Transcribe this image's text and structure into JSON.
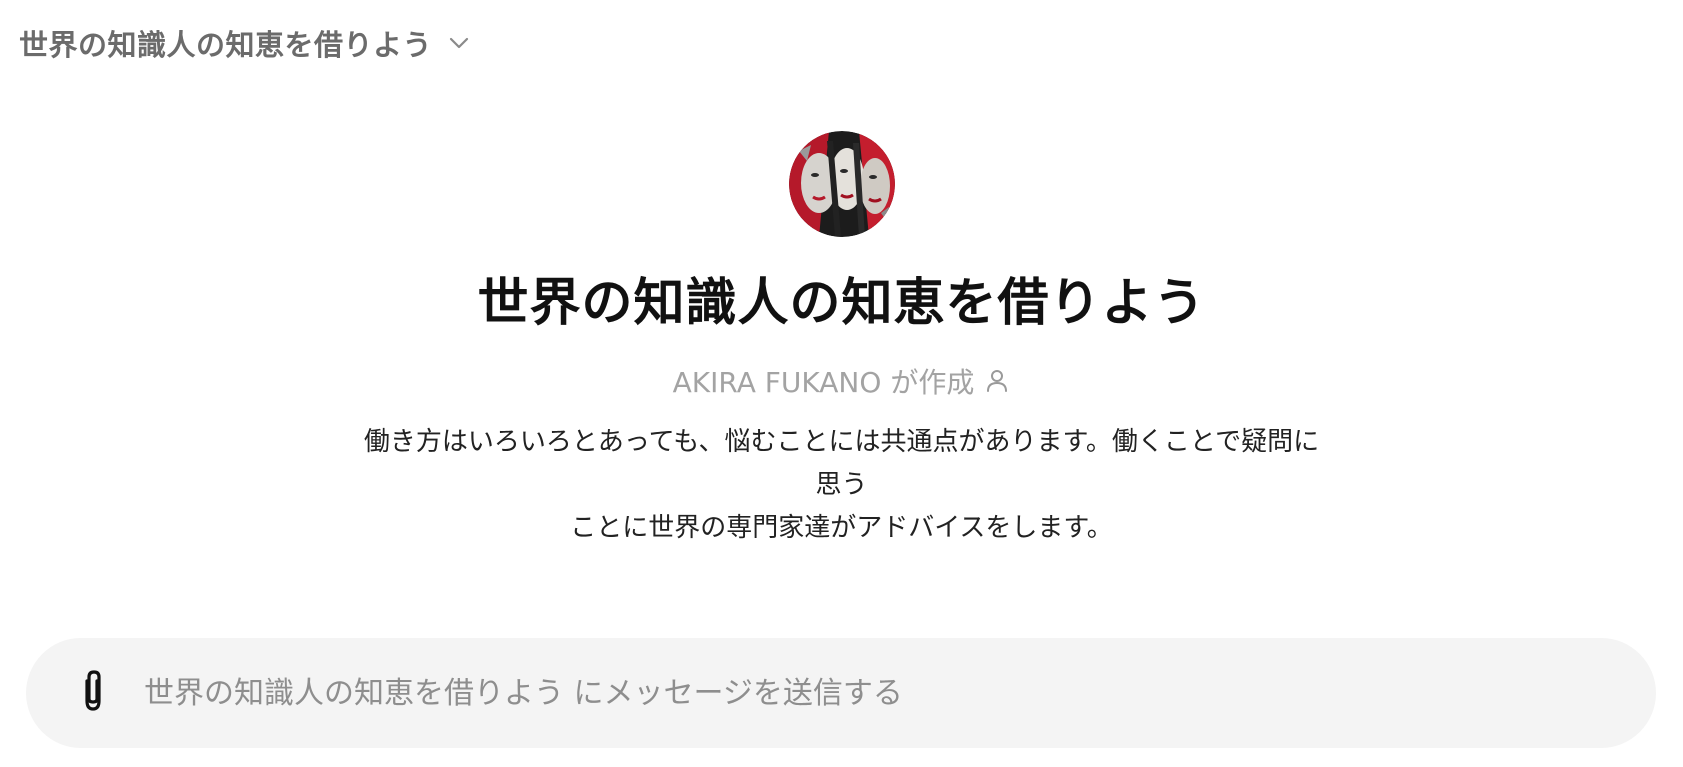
{
  "header": {
    "gpt_name": "世界の知識人の知恵を借りよう",
    "dropdown_icon": "chevron-down-icon"
  },
  "hero": {
    "avatar_icon": "gpt-avatar-faces-image",
    "title": "世界の知識人の知恵を借りよう",
    "author_line": "AKIRA FUKANO が作成",
    "author_icon": "person-icon",
    "description_line1": "働き方はいろいろとあっても、悩むことには共通点があります。働くことで疑問に思う",
    "description_line2": "ことに世界の専門家達がアドバイスをします。"
  },
  "composer": {
    "attach_icon": "paperclip-icon",
    "placeholder": "世界の知識人の知恵を借りよう にメッセージを送信する"
  },
  "colors": {
    "background": "#ffffff",
    "composer_bg": "#f4f4f4",
    "muted_text": "#a3a3a3",
    "selector_text": "#6b6b6b"
  }
}
